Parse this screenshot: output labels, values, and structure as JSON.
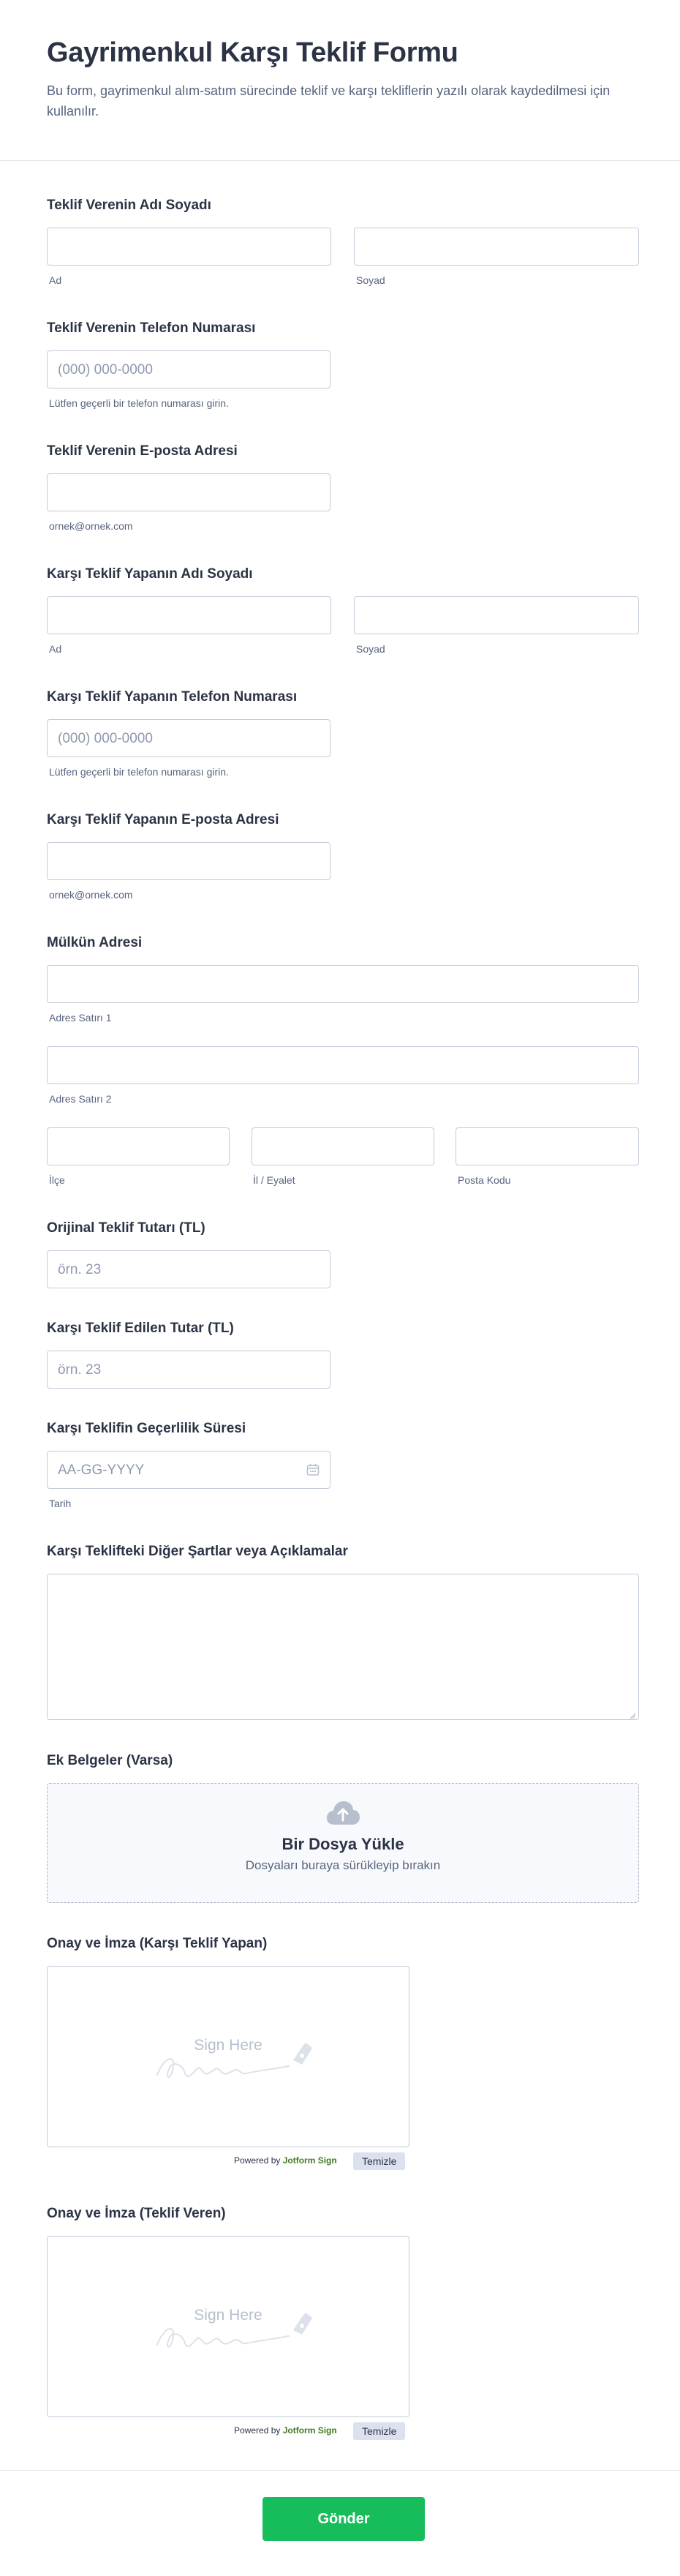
{
  "header": {
    "title": "Gayrimenkul Karşı Teklif Formu",
    "subtitle": "Bu form, gayrimenkul alım-satım sürecinde teklif ve karşı tekliflerin yazılı olarak kaydedilmesi için kullanılır."
  },
  "offerer_name": {
    "label": "Teklif Verenin Adı Soyadı",
    "first": "Ad",
    "last": "Soyad"
  },
  "offerer_phone": {
    "label": "Teklif Verenin Telefon Numarası",
    "placeholder": "(000) 000-0000",
    "hint": "Lütfen geçerli bir telefon numarası girin."
  },
  "offerer_email": {
    "label": "Teklif Verenin E-posta Adresi",
    "hint": "ornek@ornek.com"
  },
  "counter_name": {
    "label": "Karşı Teklif Yapanın Adı Soyadı",
    "first": "Ad",
    "last": "Soyad"
  },
  "counter_phone": {
    "label": "Karşı Teklif Yapanın Telefon Numarası",
    "placeholder": "(000) 000-0000",
    "hint": "Lütfen geçerli bir telefon numarası girin."
  },
  "counter_email": {
    "label": "Karşı Teklif Yapanın E-posta Adresi",
    "hint": "ornek@ornek.com"
  },
  "address": {
    "label": "Mülkün Adresi",
    "line1": "Adres Satırı 1",
    "line2": "Adres Satırı 2",
    "district": "İlçe",
    "province": "İl / Eyalet",
    "postal": "Posta Kodu"
  },
  "original_amount": {
    "label": "Orijinal Teklif Tutarı (TL)",
    "placeholder": "örn. 23"
  },
  "counter_amount": {
    "label": "Karşı Teklif Edilen Tutar (TL)",
    "placeholder": "örn. 23"
  },
  "validity": {
    "label": "Karşı Teklifin Geçerlilik Süresi",
    "placeholder": "AA-GG-YYYY",
    "hint": "Tarih"
  },
  "terms": {
    "label": "Karşı Teklifteki Diğer Şartlar veya Açıklamalar"
  },
  "attachments": {
    "label": "Ek Belgeler (Varsa)",
    "title": "Bir Dosya Yükle",
    "subtitle": "Dosyaları buraya sürükleyip bırakın"
  },
  "sign_counter": {
    "label": "Onay ve İmza (Karşı Teklif Yapan)",
    "placeholder": "Sign Here",
    "powered_prefix": "Powered by",
    "powered_brand": "Jotform Sign",
    "clear": "Temizle"
  },
  "sign_offerer": {
    "label": "Onay ve İmza (Teklif Veren)",
    "placeholder": "Sign Here",
    "powered_prefix": "Powered by",
    "powered_brand": "Jotform Sign",
    "clear": "Temizle"
  },
  "footer": {
    "submit": "Gönder"
  },
  "colors": {
    "submit": "#18bd5b",
    "border": "#c3cad8",
    "text": "#2c3345",
    "muted": "#57647e"
  }
}
